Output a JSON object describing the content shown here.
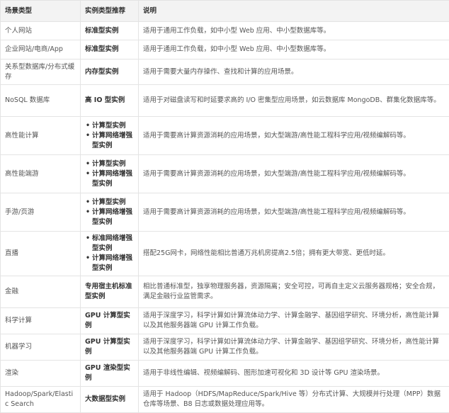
{
  "headers": [
    "场景类型",
    "实例类型推荐",
    "说明"
  ],
  "rows": [
    {
      "scene": "个人网站",
      "types": [
        "标准型实例"
      ],
      "desc": "适用于通用工作负载，如中小型 Web 应用、中小型数据库等。"
    },
    {
      "scene": "企业网站/电商/App",
      "types": [
        "标准型实例"
      ],
      "desc": "适用于通用工作负载，如中小型 Web 应用、中小型数据库等。"
    },
    {
      "scene": "关系型数据库/分布式缓存",
      "types": [
        "内存型实例"
      ],
      "desc": "适用于需要大量内存操作、查找和计算的应用场景。"
    },
    {
      "scene": "NoSQL 数据库",
      "types": [
        "高 IO 型实例"
      ],
      "desc": "适用于对磁盘读写和时延要求高的 I/O 密集型应用场景，如云数据库 MongoDB、群集化数据库等。"
    },
    {
      "scene": "高性能计算",
      "types": [
        "计算型实例",
        "计算网络增强型实例"
      ],
      "desc": "适用于需要高计算资源消耗的应用场景，如大型端游/高性能工程科学应用/视频编解码等。"
    },
    {
      "scene": "高性能端游",
      "types": [
        "计算型实例",
        "计算网络增强型实例"
      ],
      "desc": "适用于需要高计算资源消耗的应用场景，如大型端游/高性能工程科学应用/视频编解码等。"
    },
    {
      "scene": "手游/页游",
      "types": [
        "计算型实例",
        "计算网络增强型实例"
      ],
      "desc": "适用于需要高计算资源消耗的应用场景，如大型端游/高性能工程科学应用/视频编解码等。"
    },
    {
      "scene": "直播",
      "types": [
        "标准网络增强型实例",
        "计算网络增强型实例"
      ],
      "desc": "搭配25G网卡，网络性能相比普通万兆机房提高2.5倍；拥有更大带宽、更低时延。"
    },
    {
      "scene": "金融",
      "types": [
        "专用宿主机标准型实例"
      ],
      "desc": "相比普通标准型，独享物理服务器，资源隔离；安全可控，可再自主定义云服务器规格；安全合规，满足金融行业监管需求。"
    },
    {
      "scene": "科学计算",
      "types": [
        "GPU 计算型实例"
      ],
      "desc": "适用于深度学习，科学计算如计算流体动力学、计算金融学、基因组学研究、环境分析，高性能计算以及其他服务器端 GPU 计算工作负载。"
    },
    {
      "scene": "机器学习",
      "types": [
        "GPU 计算型实例"
      ],
      "desc": "适用于深度学习，科学计算如计算流体动力学、计算金融学、基因组学研究、环境分析，高性能计算以及其他服务器端 GPU 计算工作负载。"
    },
    {
      "scene": "渲染",
      "types": [
        "GPU 渲染型实例"
      ],
      "desc": "适用于非线性编辑、视频编解码、图形加速可视化和 3D 设计等 GPU 渲染场景。"
    },
    {
      "scene": "Hadoop/Spark/Elastic Search",
      "types": [
        "大数据型实例"
      ],
      "desc": "适用于 Hadoop（HDFS/MapReduce/Spark/Hive 等）分布式计算、大规模并行处理（MPP）数据仓库等场景、B8 日志或数据处理应用等。"
    }
  ]
}
